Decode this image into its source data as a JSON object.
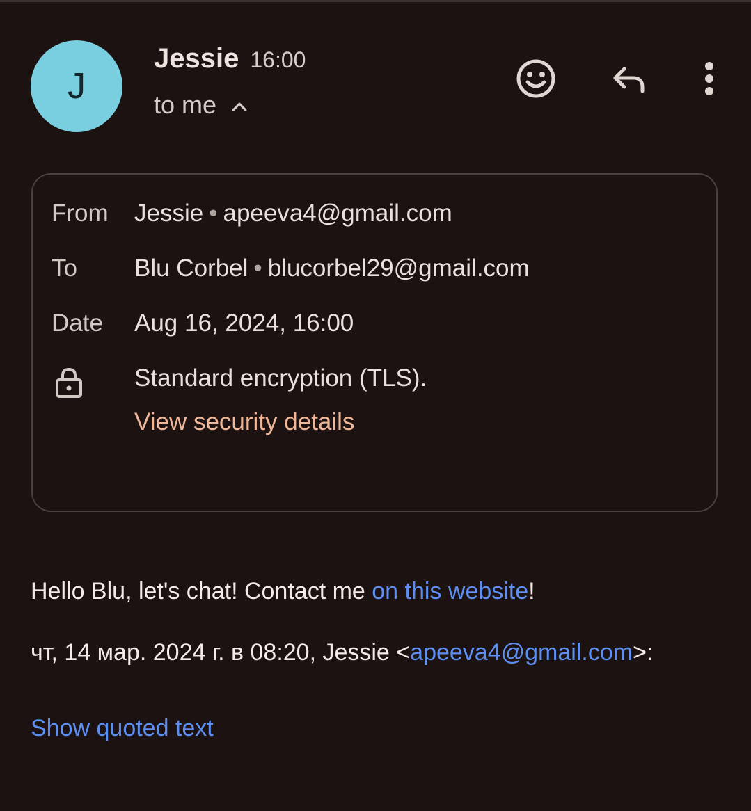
{
  "colors": {
    "background": "#1b1211",
    "avatar": "#79cfe0",
    "link": "#5d8ff2",
    "security_link": "#f0b89a"
  },
  "header": {
    "avatar_initial": "J",
    "sender_name": "Jessie",
    "time": "16:00",
    "recipient_label": "to me",
    "toggle_icon": "chevron-up-icon",
    "actions": [
      {
        "name": "emoji-reaction",
        "icon": "smiley-icon"
      },
      {
        "name": "reply",
        "icon": "reply-icon"
      },
      {
        "name": "more-options",
        "icon": "more-vert-icon"
      }
    ]
  },
  "details": {
    "from_label": "From",
    "from_name": "Jessie",
    "from_email": "apeeva4@gmail.com",
    "to_label": "To",
    "to_name": "Blu Corbel",
    "to_email": "blucorbel29@gmail.com",
    "date_label": "Date",
    "date_value": "Aug 16, 2024, 16:00",
    "separator": "•",
    "security_icon": "lock-icon",
    "security_text": "Standard encryption (TLS).",
    "security_link": "View security details"
  },
  "body": {
    "greeting_prefix": "Hello Blu, let's chat! Contact me ",
    "greeting_link": "on this website",
    "greeting_suffix": "!",
    "quote_prefix": "чт, 14 мар. 2024 г. в 08:20, Jessie <",
    "quote_email": "apeeva4@gmail.com",
    "quote_suffix": ">:",
    "show_quoted": "Show quoted text"
  }
}
